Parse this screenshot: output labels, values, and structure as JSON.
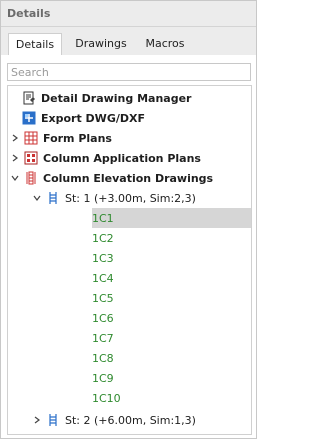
{
  "panel": {
    "title": "Details"
  },
  "tabs": [
    {
      "label": "Details",
      "active": true
    },
    {
      "label": "Drawings",
      "active": false
    },
    {
      "label": "Macros",
      "active": false
    }
  ],
  "search": {
    "placeholder": "Search",
    "value": ""
  },
  "tree": {
    "items": [
      {
        "label": "Detail Drawing Manager",
        "icon": "detail-drawing-manager-icon"
      },
      {
        "label": "Export DWG/DXF",
        "icon": "export-dwg-icon"
      },
      {
        "label": "Form Plans",
        "icon": "form-plans-icon",
        "expanded": false
      },
      {
        "label": "Column Application Plans",
        "icon": "column-application-plans-icon",
        "expanded": false
      },
      {
        "label": "Column Elevation Drawings",
        "icon": "column-elevation-drawings-icon",
        "expanded": true
      },
      {
        "label": "St: 1 (+3.00m, Sim:2,3)",
        "icon": "storey-icon",
        "expanded": true
      },
      {
        "label": "St: 2 (+6.00m, Sim:1,3)",
        "icon": "storey-icon",
        "expanded": false
      }
    ],
    "leaves": [
      "1C1",
      "1C2",
      "1C3",
      "1C4",
      "1C5",
      "1C6",
      "1C7",
      "1C8",
      "1C9",
      "1C10"
    ],
    "selected_leaf": "1C1"
  },
  "colors": {
    "leaf_text": "#2f8a2f",
    "selection": "#d6d6d6",
    "header_bg": "#ececec"
  }
}
